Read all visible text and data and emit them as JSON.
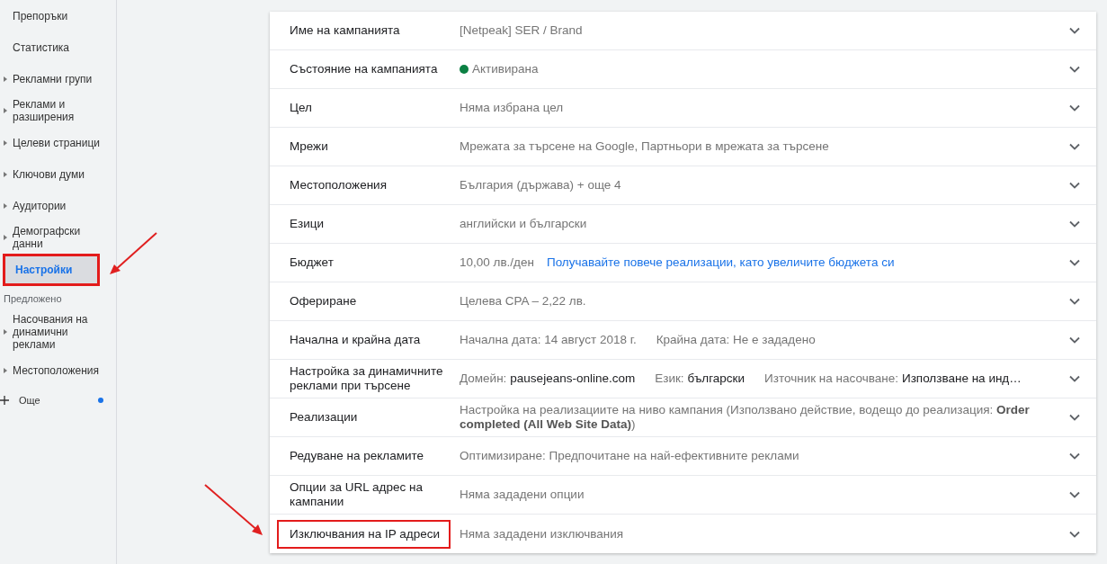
{
  "sidebar": {
    "items": [
      {
        "label": "Препоръки",
        "expandable": false,
        "selected": false,
        "highlighted": false
      },
      {
        "label": "Статистика",
        "expandable": false,
        "selected": false,
        "highlighted": false
      },
      {
        "label": "Рекламни групи",
        "expandable": true,
        "selected": false,
        "highlighted": false
      },
      {
        "label": "Реклами и разширения",
        "expandable": true,
        "selected": false,
        "highlighted": false
      },
      {
        "label": "Целеви страници",
        "expandable": true,
        "selected": false,
        "highlighted": false
      },
      {
        "label": "Ключови думи",
        "expandable": true,
        "selected": false,
        "highlighted": false
      },
      {
        "label": "Аудитории",
        "expandable": true,
        "selected": false,
        "highlighted": false
      },
      {
        "label": "Демографски данни",
        "expandable": true,
        "selected": false,
        "highlighted": false
      },
      {
        "label": "Настройки",
        "expandable": false,
        "selected": true,
        "highlighted": true
      }
    ],
    "section_label": "Предложено",
    "suggested_items": [
      {
        "label": "Насочвания на динамични реклами",
        "expandable": true,
        "selected": false,
        "highlighted": false
      },
      {
        "label": "Местоположения",
        "expandable": true,
        "selected": false,
        "highlighted": false
      }
    ],
    "more": {
      "label": "Още",
      "notification": true
    }
  },
  "settings": {
    "rows": [
      {
        "label": "Име на кампанията",
        "highlighted": false,
        "value": [
          {
            "kind": "text",
            "text": "[Netpeak] SER / Brand"
          }
        ]
      },
      {
        "label": "Състояние на кампанията",
        "highlighted": false,
        "value": [
          {
            "kind": "status",
            "text": "Активирана",
            "color": "#0b8043"
          }
        ]
      },
      {
        "label": "Цел",
        "highlighted": false,
        "value": [
          {
            "kind": "text",
            "text": "Няма избрана цел"
          }
        ]
      },
      {
        "label": "Мрежи",
        "highlighted": false,
        "value": [
          {
            "kind": "text",
            "text": "Мрежата за търсене на Google, Партньори в мрежата за търсене"
          }
        ]
      },
      {
        "label": "Местоположения",
        "highlighted": false,
        "value": [
          {
            "kind": "text",
            "text": "България (държава) + още 4"
          }
        ]
      },
      {
        "label": "Езици",
        "highlighted": false,
        "value": [
          {
            "kind": "text",
            "text": "английски и български"
          }
        ]
      },
      {
        "label": "Бюджет",
        "highlighted": false,
        "value": [
          {
            "kind": "text",
            "text": "10,00 лв./ден"
          },
          {
            "kind": "link",
            "text": "Получавайте повече реализации, като увеличите бюджета си"
          }
        ]
      },
      {
        "label": "Офериране",
        "highlighted": false,
        "value": [
          {
            "kind": "text",
            "text": "Целева CPA – 2,22 лв."
          }
        ]
      },
      {
        "label": "Начална и крайна дата",
        "highlighted": false,
        "value": [
          {
            "kind": "text",
            "text": "Начална дата: 14 август 2018 г."
          },
          {
            "kind": "text",
            "text": "Крайна дата: Не е зададено"
          }
        ]
      },
      {
        "label": "Настройка за динамичните реклами при търсене",
        "highlighted": false,
        "value": [
          {
            "kind": "pair",
            "key": "Домейн:",
            "text": "pausejeans-online.com"
          },
          {
            "kind": "pair",
            "key": "Език:",
            "text": "български"
          },
          {
            "kind": "pair",
            "key": "Източник на насочване:",
            "text": "Използване на инд…"
          }
        ]
      },
      {
        "label": "Реализации",
        "highlighted": false,
        "value": [
          {
            "kind": "rich",
            "text": "Настройка на реализациите на ниво кампания (Използвано действие, водещо до реализация: **Order completed (All Web Site Data)**)"
          }
        ]
      },
      {
        "label": "Редуване на рекламите",
        "highlighted": false,
        "value": [
          {
            "kind": "text",
            "text": "Оптимизиране: Предпочитане на най-ефективните реклами"
          }
        ]
      },
      {
        "label": "Опции за URL адрес на кампании",
        "highlighted": false,
        "value": [
          {
            "kind": "text",
            "text": "Няма зададени опции"
          }
        ]
      },
      {
        "label": "Изключвания на IP адреси",
        "highlighted": true,
        "value": [
          {
            "kind": "text",
            "text": "Няма зададени изключвания"
          }
        ]
      }
    ]
  }
}
